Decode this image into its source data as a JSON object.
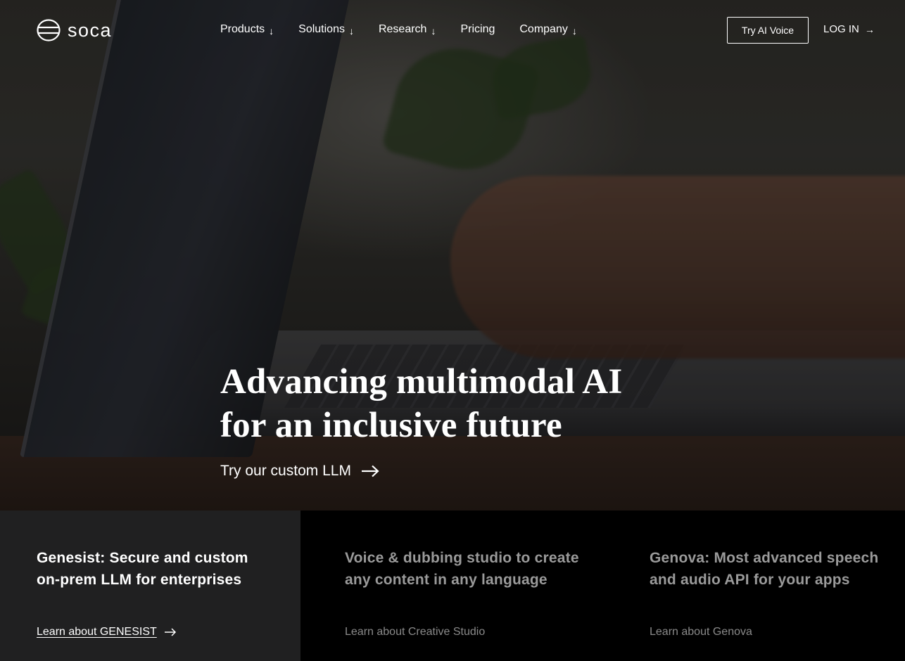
{
  "brand": {
    "name": "soca",
    "logo_icon": "soca-logo-icon"
  },
  "nav": {
    "items": [
      {
        "label": "Products",
        "has_dropdown": true,
        "arrow": "↓"
      },
      {
        "label": "Solutions",
        "has_dropdown": true,
        "arrow": "↓"
      },
      {
        "label": "Research",
        "has_dropdown": true,
        "arrow": "↓"
      },
      {
        "label": "Pricing",
        "has_dropdown": false,
        "arrow": ""
      },
      {
        "label": "Company",
        "has_dropdown": true,
        "arrow": "↓"
      }
    ],
    "try_button": "Try AI Voice",
    "login": "LOG IN",
    "login_arrow": "→"
  },
  "hero": {
    "title_line1": "Advancing multimodal AI",
    "title_line2": "for an inclusive future",
    "cta": "Try our custom LLM",
    "cta_icon": "arrow-right-icon"
  },
  "cards": [
    {
      "title_line1": "Genesist: Secure and custom",
      "title_line2": "on-prem LLM for enterprises",
      "link": "Learn about GENESIST",
      "active": true
    },
    {
      "title_line1": "Voice & dubbing studio to create",
      "title_line2": "any content in any language",
      "link": "Learn about Creative Studio",
      "active": false
    },
    {
      "title_line1": "Genova: Most advanced speech",
      "title_line2": "and audio API for your apps",
      "link": "Learn about Genova",
      "active": false
    }
  ],
  "colors": {
    "active_card_bg": "#202021",
    "inactive_text": "#9a9a9a",
    "text": "#ffffff",
    "background": "#000000"
  }
}
